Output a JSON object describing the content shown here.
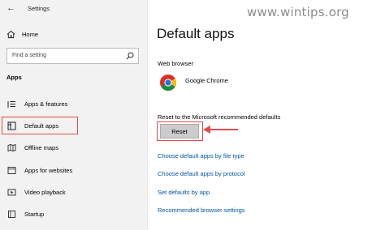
{
  "window": {
    "title": "Settings"
  },
  "sidebar": {
    "home_label": "Home",
    "search_placeholder": "Find a setting",
    "section_label": "Apps",
    "items": [
      {
        "label": "Apps & features",
        "icon": "list-icon"
      },
      {
        "label": "Default apps",
        "icon": "default-apps-icon"
      },
      {
        "label": "Offline maps",
        "icon": "map-icon"
      },
      {
        "label": "Apps for websites",
        "icon": "websites-icon"
      },
      {
        "label": "Video playback",
        "icon": "video-icon"
      },
      {
        "label": "Startup",
        "icon": "startup-icon"
      }
    ]
  },
  "main": {
    "title": "Default apps",
    "web_browser_label": "Web browser",
    "browser_name": "Google Chrome",
    "reset_label": "Reset to the Microsoft recommended defaults",
    "reset_button": "Reset",
    "links": [
      "Choose default apps by file type",
      "Choose default apps by protocol",
      "Set defaults by app",
      "Recommended browser settings"
    ]
  },
  "watermark": "www.wintips.org",
  "colors": {
    "accent_link": "#0055a6",
    "highlight": "#e24b4b",
    "sidebar_bg": "#f2f2f2"
  }
}
